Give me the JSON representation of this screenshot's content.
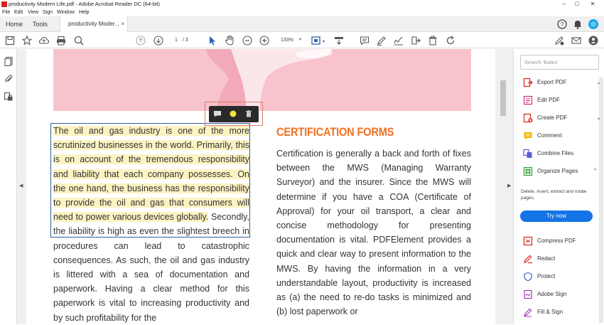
{
  "window": {
    "title": "productivity Modern Life.pdf - Adobe Acrobat Reader DC (64-bit)",
    "controls": {
      "minimize": "–",
      "maximize": "▢",
      "close": "✕"
    }
  },
  "menu": [
    "File",
    "Edit",
    "View",
    "Sign",
    "Window",
    "Help"
  ],
  "tabs": {
    "home": "Home",
    "tools": "Tools",
    "document": "productivity Moder...",
    "close": "×"
  },
  "toolbar": {
    "page_current": "1",
    "page_total": "/ 3",
    "zoom": "133%",
    "zoom_dd": "▾"
  },
  "document": {
    "highlighted_text": "The oil and gas industry is one of the more scrutinized businesses in the world. Primarily, this is on account of the tremendous responsibility and liability that each company possesses. On the one hand, the business has the responsibility to provide the oil and gas that consumers will need to power various devices globally.",
    "continued_text": " Secondly, the liability is high as even the slightest breech in procedures can lead to catastrophic consequences. As such, the oil and gas industry is littered with a sea of documentation and paperwork. Having a clear method for this paperwork is vital to increasing productivity and by such profitability for the",
    "heading": "CERTIFICATION FORMS",
    "right_text": "Certification is generally a back and forth of fixes between the MWS (Managing Warranty Surveyor) and the insurer. Since the MWS will determine if you have a COA (Certificate of Approval) for your oil transport, a clear and concise methodology for presenting documentation is vital. PDFElement provides a quick and clear way to present information to the MWS. By having the information in a very understandable layout, productivity is increased as (a) the need to re-do tasks is minimized and (b) lost paperwork or"
  },
  "right_panel": {
    "search_placeholder": "Search 'Bates'",
    "tools": [
      {
        "label": "Export PDF",
        "icon": "export-pdf-icon",
        "color": "#d9251d",
        "chev": "⌄"
      },
      {
        "label": "Edit PDF",
        "icon": "edit-pdf-icon",
        "color": "#d4307a"
      },
      {
        "label": "Create PDF",
        "icon": "create-pdf-icon",
        "color": "#d9251d",
        "chev": "⌄"
      },
      {
        "label": "Comment",
        "icon": "comment-icon",
        "color": "#f2b705"
      },
      {
        "label": "Combine Files",
        "icon": "combine-files-icon",
        "color": "#5b5bd6"
      },
      {
        "label": "Organize Pages",
        "icon": "organize-pages-icon",
        "color": "#3b9b3b",
        "chev": "⌃"
      }
    ],
    "organize_desc": "Delete, insert, extract and rotate pages.",
    "try_now": "Try now",
    "tools2": [
      {
        "label": "Compress PDF",
        "icon": "compress-pdf-icon",
        "color": "#d9251d"
      },
      {
        "label": "Redact",
        "icon": "redact-icon",
        "color": "#d9251d"
      },
      {
        "label": "Protect",
        "icon": "protect-icon",
        "color": "#3d5fc4"
      },
      {
        "label": "Adobe Sign",
        "icon": "adobe-sign-icon",
        "color": "#9b3fb5"
      },
      {
        "label": "Fill & Sign",
        "icon": "fill-sign-icon",
        "color": "#9b3fb5"
      }
    ]
  },
  "colors": {
    "accent": "#1473e6",
    "heading": "#f36f21",
    "highlight": "#fcf3c2",
    "hero": "#f7c3cc"
  }
}
